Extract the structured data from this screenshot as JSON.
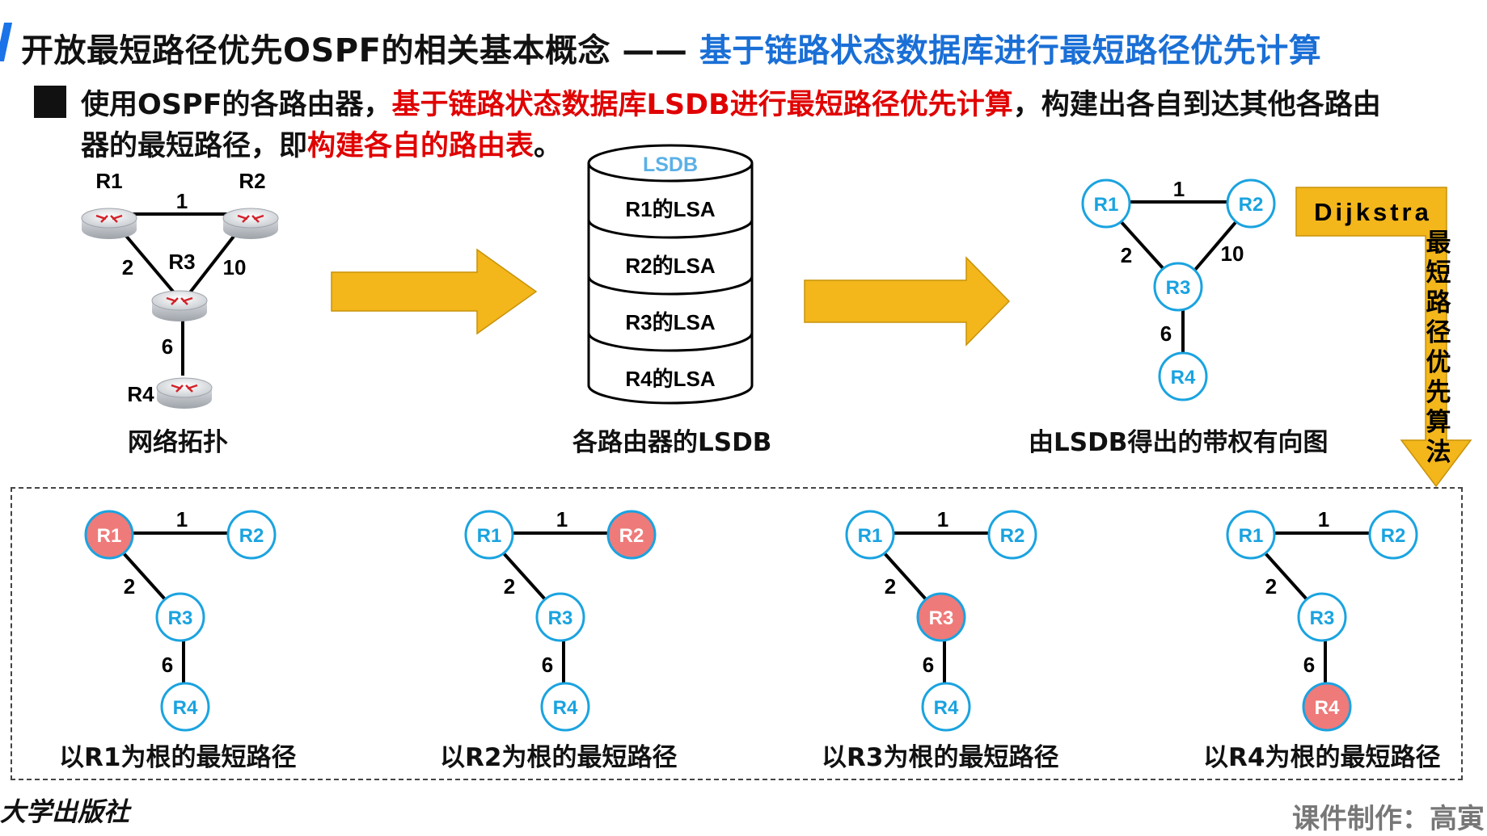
{
  "header": {
    "title_main": "开放最短路径优先OSPF的相关基本概念 —— ",
    "title_sub": "基于链路状态数据库进行最短路径优先计算"
  },
  "bullet": {
    "part1": "使用OSPF的各路由器，",
    "part2_red": "基于链路状态数据库LSDB进行最短路径优先计算",
    "part3": "，构建出各自到达其他各路由",
    "part4": "器的最短路径，即",
    "part5_red": "构建各自的路由表",
    "part6": "。"
  },
  "topology": {
    "caption": "网络拓扑",
    "routers": [
      "R1",
      "R2",
      "R3",
      "R4"
    ],
    "weights": [
      "1",
      "2",
      "10",
      "6"
    ]
  },
  "lsdb": {
    "header": "LSDB",
    "entries": [
      "R1的LSA",
      "R2的LSA",
      "R3的LSA",
      "R4的LSA"
    ],
    "caption": "各路由器的LSDB"
  },
  "graph": {
    "caption": "由LSDB得出的带权有向图",
    "nodes": [
      "R1",
      "R2",
      "R3",
      "R4"
    ],
    "weights": [
      "1",
      "2",
      "10",
      "6"
    ]
  },
  "dijkstra": {
    "label": "Dijkstra",
    "vertical_text": [
      "最",
      "短",
      "路",
      "径",
      "优",
      "先",
      "算",
      "法"
    ]
  },
  "trees": [
    {
      "root": "R1",
      "caption": "以R1为根的最短路径"
    },
    {
      "root": "R2",
      "caption": "以R2为根的最短路径"
    },
    {
      "root": "R3",
      "caption": "以R3为根的最短路径"
    },
    {
      "root": "R4",
      "caption": "以R4为根的最短路径"
    }
  ],
  "tree_weights": [
    "1",
    "2",
    "6"
  ],
  "footer": {
    "publisher": "大学出版社",
    "credit": "课件制作：高寅"
  },
  "colors": {
    "accent_blue": "#1a6fd6",
    "node_blue": "#1aa3e0",
    "root_fill": "#ef7a7a",
    "arrow_fill": "#f3b61b",
    "red_text": "#e00000"
  }
}
